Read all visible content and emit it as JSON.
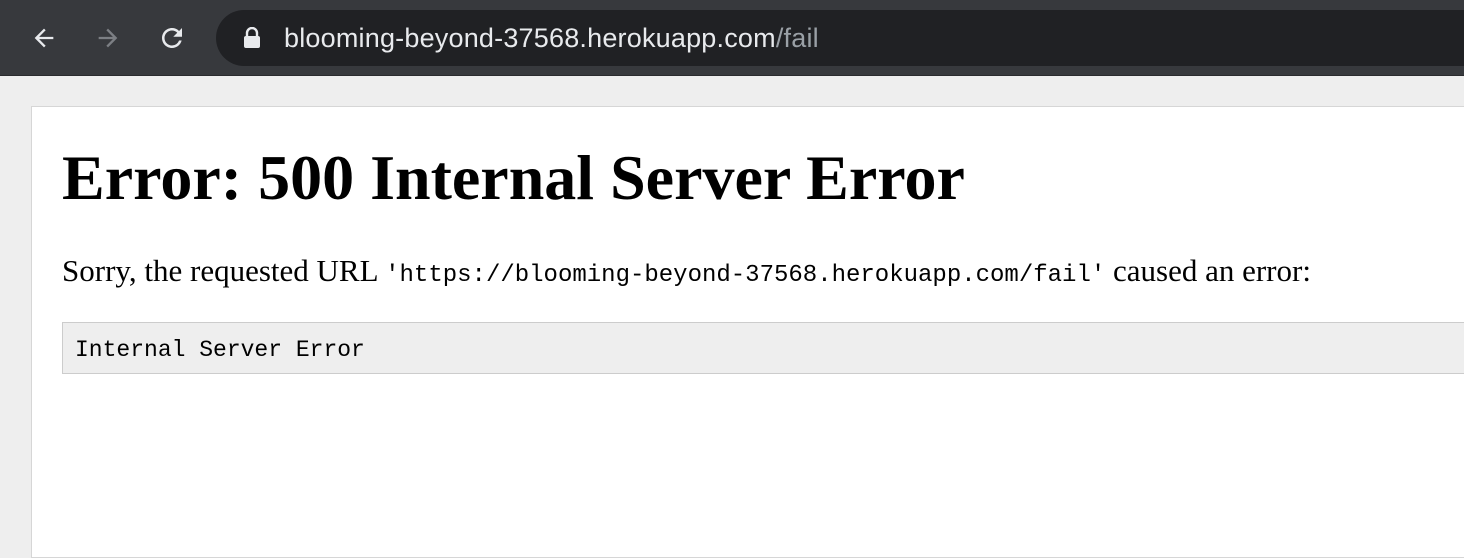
{
  "browser": {
    "url_host": "blooming-beyond-37568.herokuapp.com",
    "url_path": "/fail",
    "icons": {
      "back": "arrow-left-icon",
      "forward": "arrow-right-icon",
      "reload": "reload-icon",
      "lock": "lock-icon"
    }
  },
  "page": {
    "heading": "Error: 500 Internal Server Error",
    "message_prefix": "Sorry, the requested URL",
    "requested_url": "'https://blooming-beyond-37568.herokuapp.com/fail'",
    "message_suffix": "caused an error:",
    "error_detail": "Internal Server Error"
  },
  "colors": {
    "toolbar_bg": "#37393d",
    "omnibox_bg": "#202124",
    "page_bg": "#ffffff",
    "pre_bg": "#eeeeee"
  }
}
